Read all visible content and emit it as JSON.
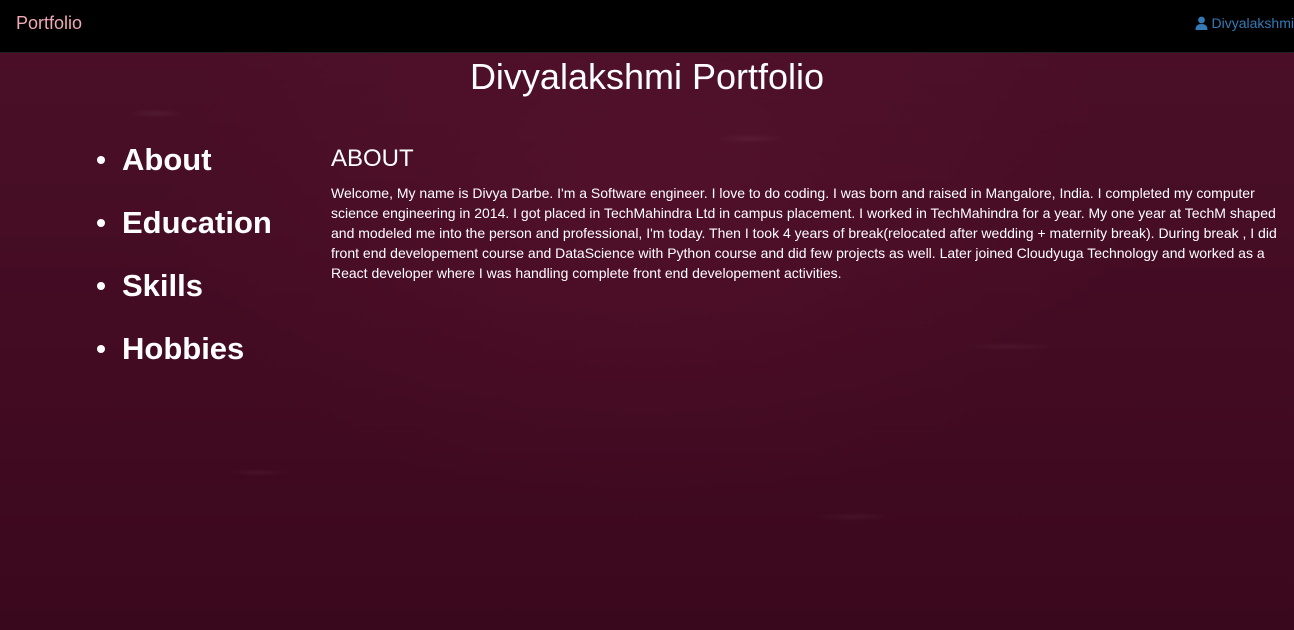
{
  "navbar": {
    "brand": "Portfolio",
    "user_name": "Divyalakshmi",
    "user_icon": "user-icon"
  },
  "page": {
    "title": "Divyalakshmi Portfolio"
  },
  "sidebar": {
    "items": [
      {
        "label": "About"
      },
      {
        "label": "Education"
      },
      {
        "label": "Skills"
      },
      {
        "label": "Hobbies"
      }
    ]
  },
  "about": {
    "heading": "ABOUT",
    "body": "Welcome, My name is Divya Darbe. I'm a Software engineer. I love to do coding. I was born and raised in Mangalore, India. I completed my computer science engineering in 2014. I got placed in TechMahindra Ltd in campus placement. I worked in TechMahindra for a year. My one year at TechM shaped and modeled me into the person and professional, I'm today. Then I took 4 years of break(relocated after wedding + maternity break). During break , I did front end developement course and DataScience with Python course and did few projects as well. Later joined Cloudyuga Technology and worked as a React developer where I was handling complete front end developement activities."
  },
  "colors": {
    "navbar_bg": "#000000",
    "brand": "#f0a8b4",
    "user_link": "#337ab7",
    "page_bg": "#4a0f26",
    "text": "#ffffff"
  }
}
